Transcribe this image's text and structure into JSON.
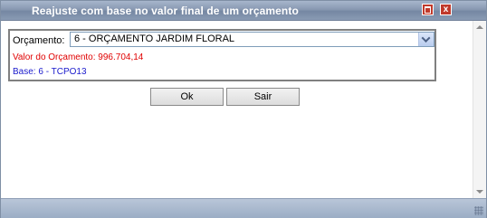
{
  "window": {
    "title": "Reajuste com base no valor final de um orçamento",
    "close_glyph": "x"
  },
  "form": {
    "orcamento_label": "Orçamento:",
    "orcamento_value": "6 - ORÇAMENTO JARDIM FLORAL",
    "valor_text": "Valor do Orçamento: 996.704,14",
    "base_text": "Base: 6 - TCPO13"
  },
  "buttons": {
    "ok_label": "Ok",
    "sair_label": "Sair"
  },
  "colors": {
    "valor": "#e00000",
    "base": "#1a1acc",
    "titlebar": "#8898b1"
  }
}
